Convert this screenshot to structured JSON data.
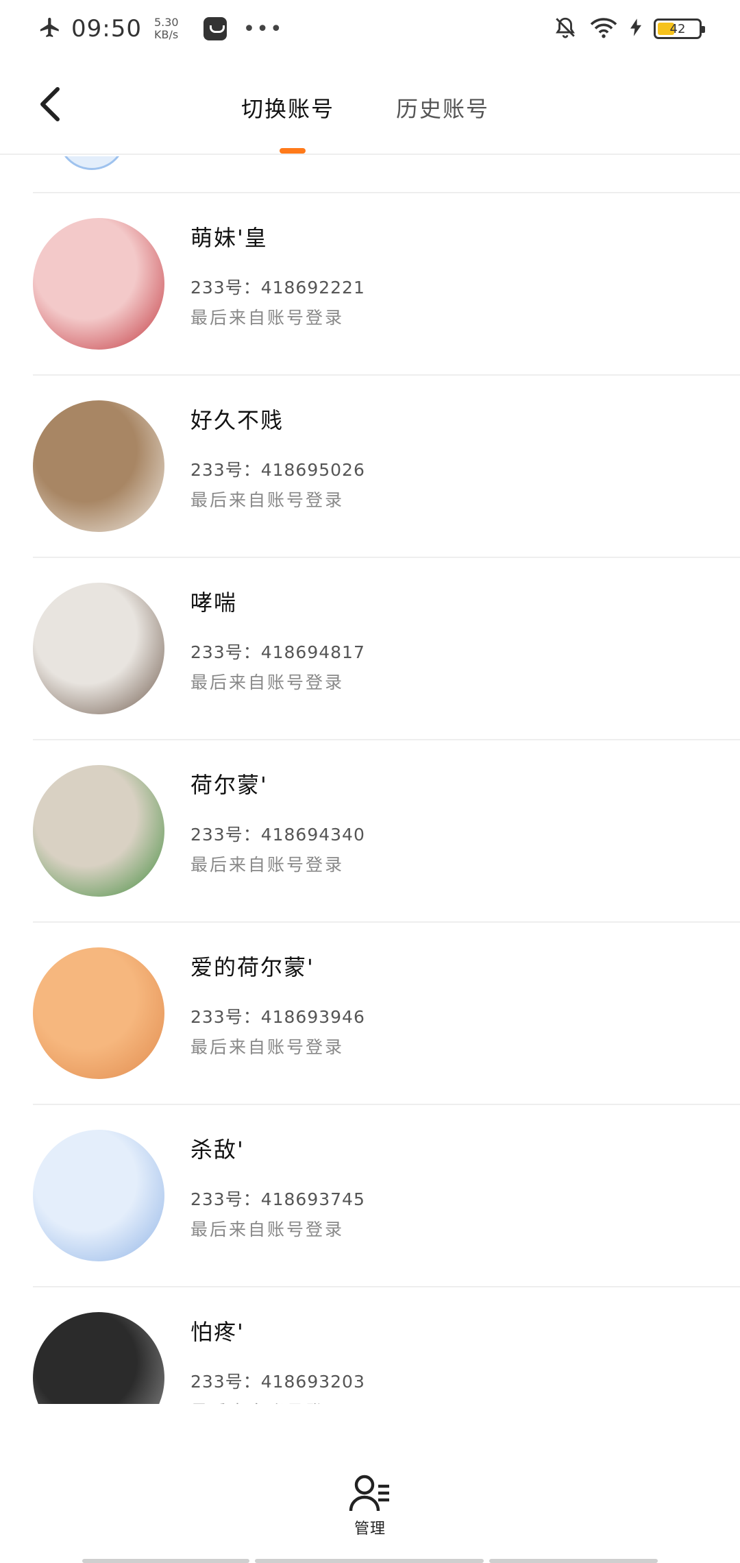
{
  "status_bar": {
    "time": "09:50",
    "net_speed_value": "5.30",
    "net_speed_unit": "KB/s",
    "more": "•••",
    "battery": "42",
    "battery_level": 0.42
  },
  "header": {
    "tabs": [
      {
        "label": "切换账号",
        "active": true
      },
      {
        "label": "历史账号",
        "active": false
      }
    ],
    "accent_color": "#ff7a1a"
  },
  "accounts": [
    {
      "name": "萌妹'皇",
      "id_prefix": "233号：",
      "id": "418692221",
      "last_login": "最后来自账号登录",
      "avatar_colors": [
        "#f3c9c9",
        "#c0323a"
      ]
    },
    {
      "name": "好久不贱",
      "id_prefix": "233号：",
      "id": "418695026",
      "last_login": "最后来自账号登录",
      "avatar_colors": [
        "#a88664",
        "#f2ede6"
      ]
    },
    {
      "name": "哮喘",
      "id_prefix": "233号：",
      "id": "418694817",
      "last_login": "最后来自账号登录",
      "avatar_colors": [
        "#e8e4df",
        "#6b5648"
      ]
    },
    {
      "name": "荷尔蒙'",
      "id_prefix": "233号：",
      "id": "418694340",
      "last_login": "最后来自账号登录",
      "avatar_colors": [
        "#d9d1c3",
        "#3e8b3a"
      ]
    },
    {
      "name": "爱的荷尔蒙'",
      "id_prefix": "233号：",
      "id": "418693946",
      "last_login": "最后来自账号登录",
      "avatar_colors": [
        "#f6b77e",
        "#e08a4d"
      ]
    },
    {
      "name": "杀敌'",
      "id_prefix": "233号：",
      "id": "418693745",
      "last_login": "最后来自账号登录",
      "avatar_colors": [
        "#e4eefb",
        "#8fb3e6"
      ]
    },
    {
      "name": "怕疼'",
      "id_prefix": "233号：",
      "id": "418693203",
      "last_login": "最后来自账号登录",
      "avatar_colors": [
        "#2b2b2b",
        "#9a9a9a"
      ]
    }
  ],
  "bottom_bar": {
    "manage_label": "管理"
  }
}
